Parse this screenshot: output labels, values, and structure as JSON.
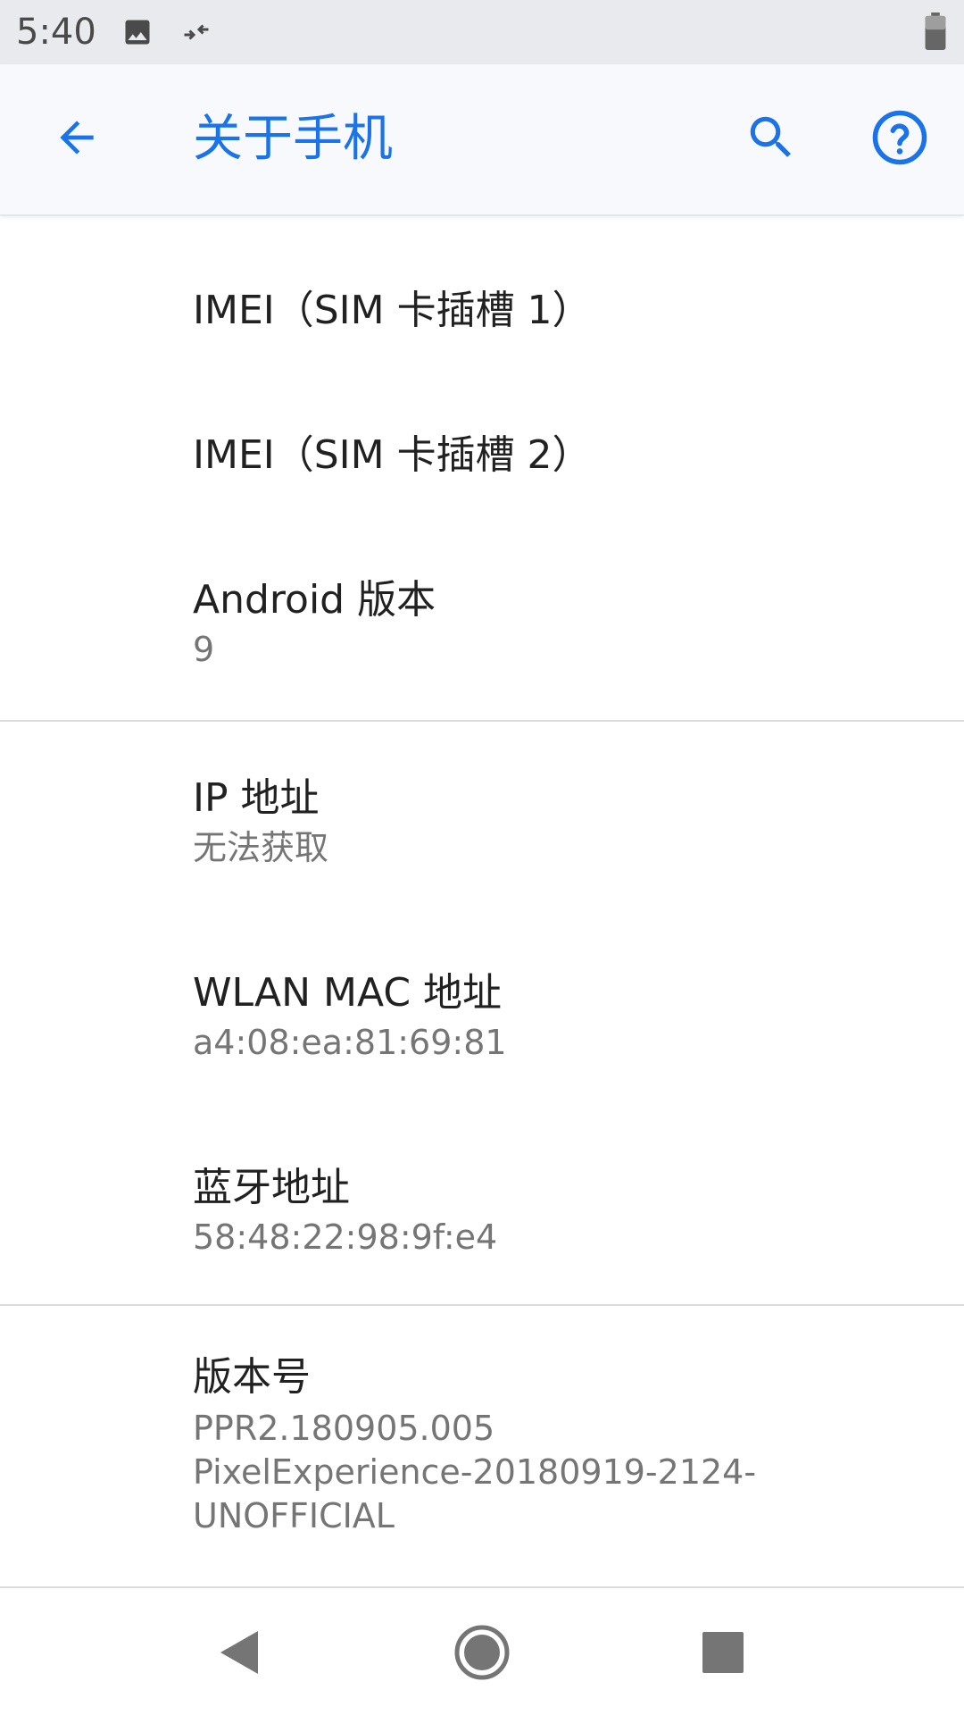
{
  "status_bar": {
    "time": "5:40",
    "icons": [
      "image-icon",
      "data-saver-icon",
      "battery-icon"
    ]
  },
  "app_bar": {
    "title": "关于手机",
    "back_icon": "arrow-back-icon",
    "search_icon": "search-icon",
    "help_icon": "help-icon",
    "accent_color": "#1a73e8"
  },
  "items": [
    {
      "title": "IMEI（SIM 卡插槽 1）"
    },
    {
      "title": "IMEI（SIM 卡插槽 2）"
    },
    {
      "title": "Android 版本",
      "summary": "9"
    },
    {
      "title": "IP 地址",
      "summary": "无法获取"
    },
    {
      "title": "WLAN MAC 地址",
      "summary": "a4:08:ea:81:69:81"
    },
    {
      "title": "蓝牙地址",
      "summary": "58:48:22:98:9f:e4"
    },
    {
      "title": "版本号",
      "summary_lines": [
        "PPR2.180905.005",
        "PixelExperience-20180919-2124-",
        "UNOFFICIAL"
      ]
    }
  ],
  "nav_bar": {
    "icons": [
      "nav-back-icon",
      "nav-home-icon",
      "nav-recents-icon"
    ]
  }
}
